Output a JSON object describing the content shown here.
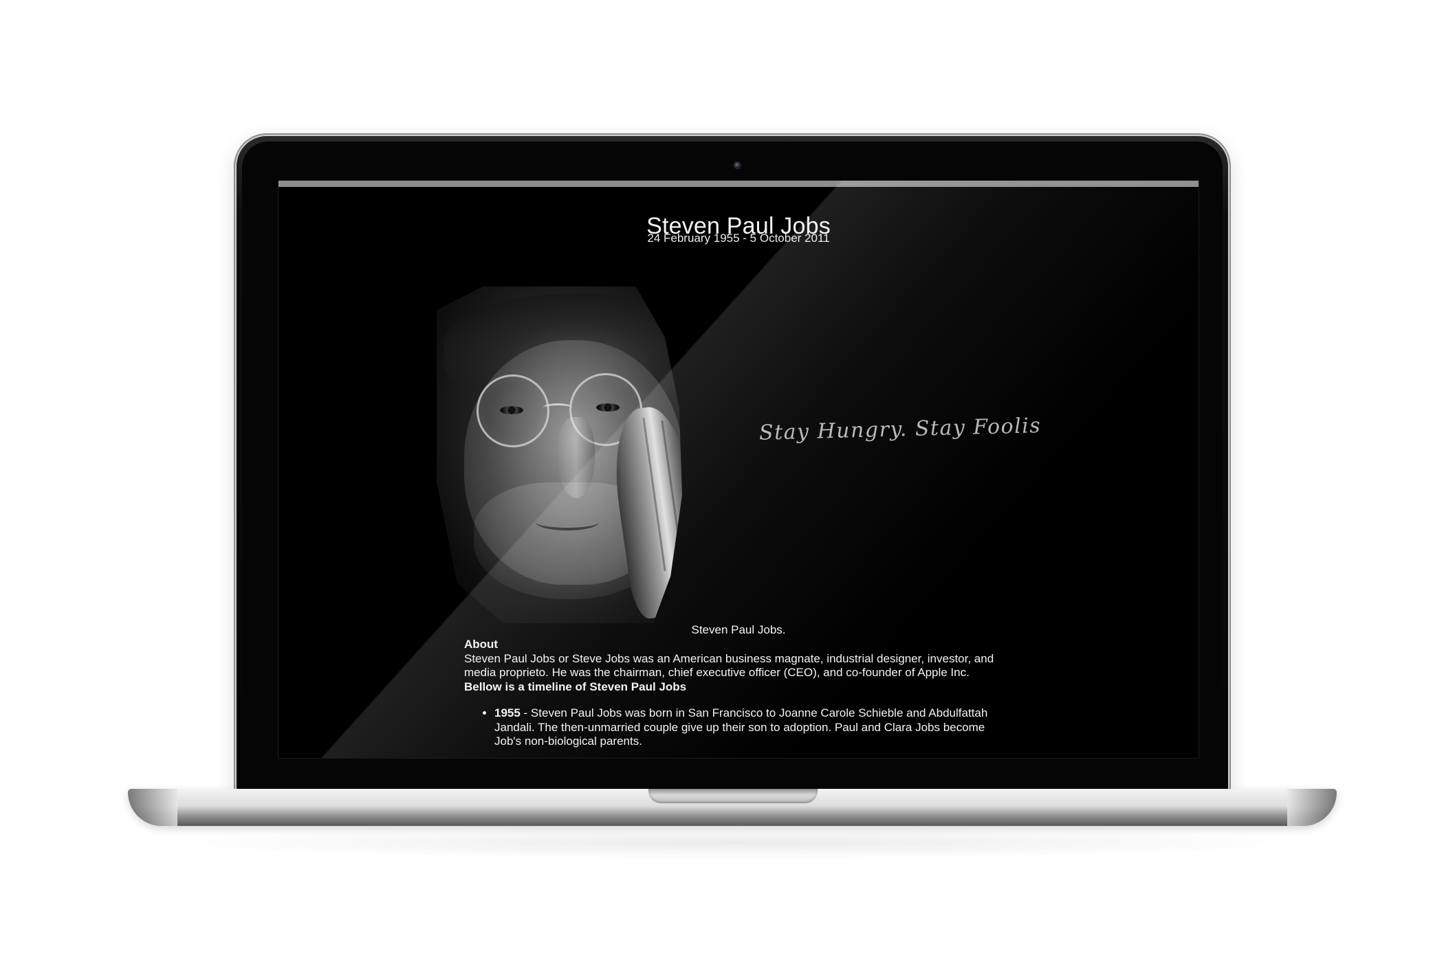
{
  "page": {
    "title": "Steven Paul Jobs",
    "dates": "24 February 1955 - 5 October 2011",
    "hero_motto": "Stay Hungry. Stay Foolish.",
    "caption": "Steven Paul Jobs."
  },
  "about": {
    "heading": "About",
    "text": "Steven Paul Jobs or Steve Jobs was an American business magnate, industrial designer, investor, and media proprieto. He was the chairman, chief executive officer (CEO), and co-founder of Apple Inc."
  },
  "timeline": {
    "heading": "Bellow is a timeline of Steven Paul Jobs",
    "items": [
      {
        "year": "1955",
        "text": " - Steven Paul Jobs was born in San Francisco to Joanne Carole Schieble and Abdulfattah Jandali. The then-unmarried couple give up their son to adoption. Paul and Clara Jobs become Job's non-biological parents."
      }
    ]
  },
  "colors": {
    "background": "#000000",
    "text": "#f3f3f3",
    "browser_bar": "#8e8e8e"
  },
  "icons": {
    "camera": "camera-icon"
  }
}
